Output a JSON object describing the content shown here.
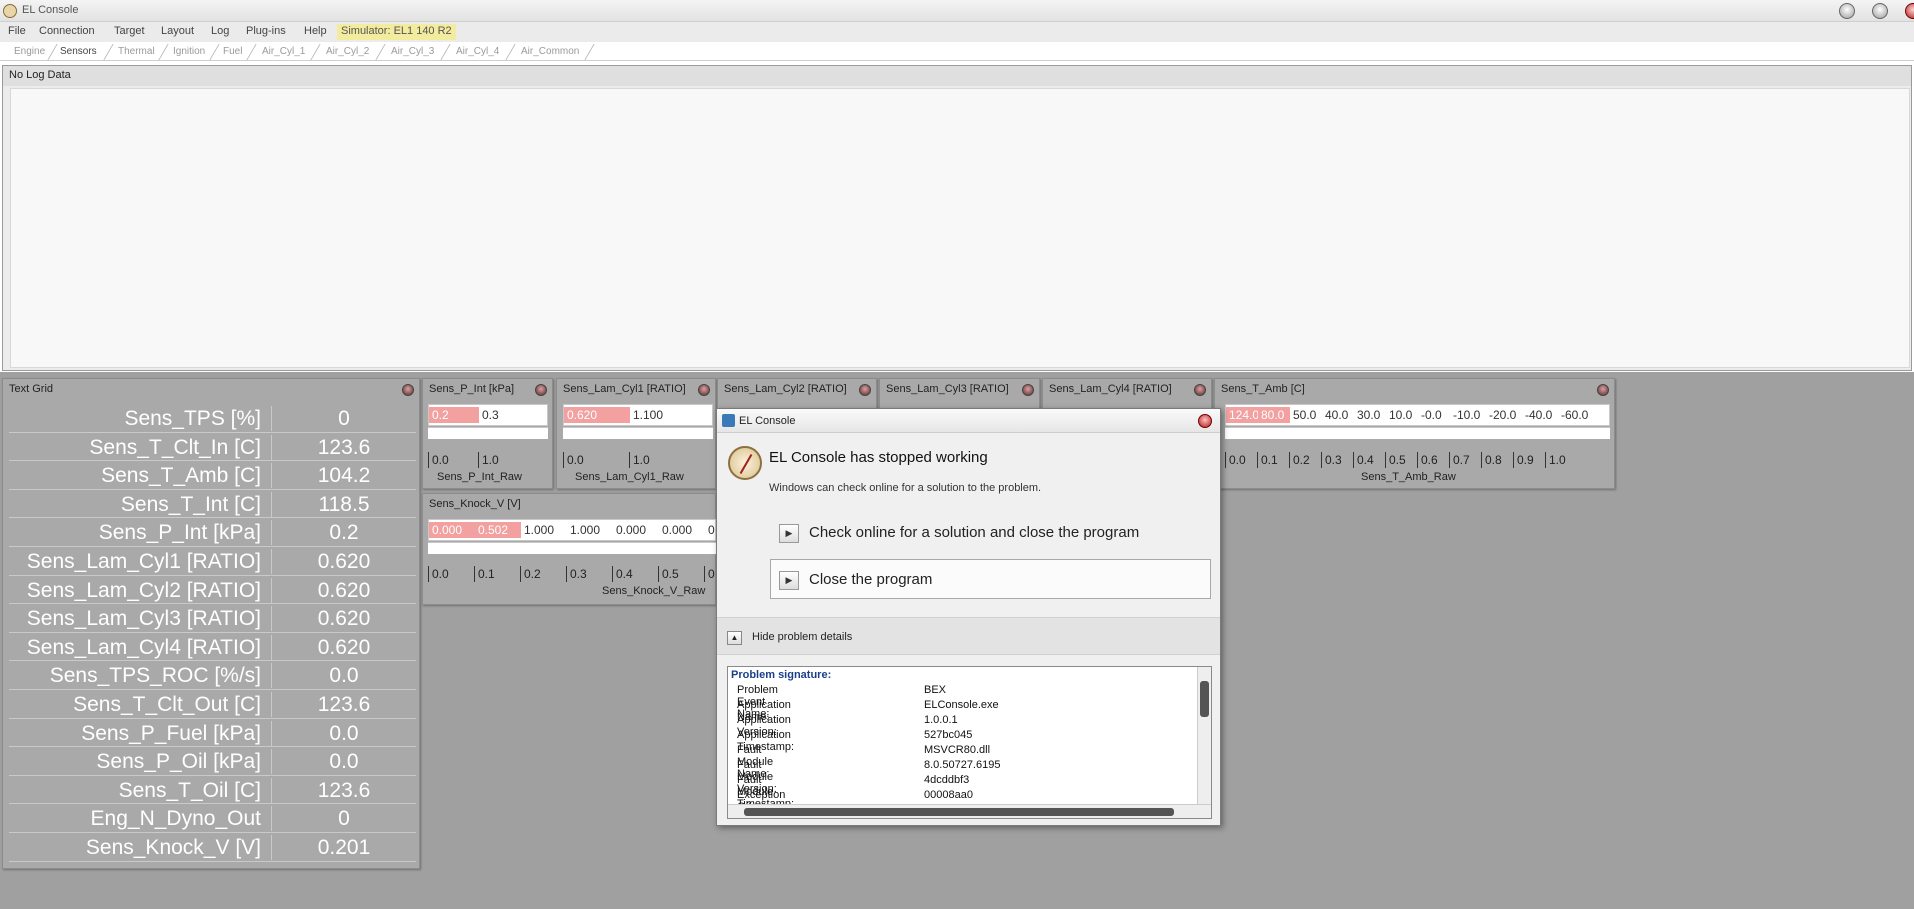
{
  "window": {
    "title": "EL Console"
  },
  "menu": {
    "items": [
      "File",
      "Connection",
      "Target",
      "Layout",
      "Log",
      "Plug-ins",
      "Help"
    ],
    "simulator": "Simulator: EL1 140 R2"
  },
  "tabs": [
    "Engine",
    "Sensors",
    "Thermal",
    "Ignition",
    "Fuel",
    "Air_Cyl_1",
    "Air_Cyl_2",
    "Air_Cyl_3",
    "Air_Cyl_4",
    "Air_Common"
  ],
  "active_tab": "Sensors",
  "log": {
    "header": "No Log Data"
  },
  "text_grid": {
    "title": "Text Grid",
    "rows": [
      {
        "label": "Sens_TPS [%]",
        "value": "0"
      },
      {
        "label": "Sens_T_Clt_In [C]",
        "value": "123.6"
      },
      {
        "label": "Sens_T_Amb [C]",
        "value": "104.2"
      },
      {
        "label": "Sens_T_Int [C]",
        "value": "118.5"
      },
      {
        "label": "Sens_P_Int [kPa]",
        "value": "0.2"
      },
      {
        "label": "Sens_Lam_Cyl1 [RATIO]",
        "value": "0.620"
      },
      {
        "label": "Sens_Lam_Cyl2 [RATIO]",
        "value": "0.620"
      },
      {
        "label": "Sens_Lam_Cyl3 [RATIO]",
        "value": "0.620"
      },
      {
        "label": "Sens_Lam_Cyl4 [RATIO]",
        "value": "0.620"
      },
      {
        "label": "Sens_TPS_ROC [%/s]",
        "value": "0.0"
      },
      {
        "label": "Sens_T_Clt_Out [C]",
        "value": "123.6"
      },
      {
        "label": "Sens_P_Fuel [kPa]",
        "value": "0.0"
      },
      {
        "label": "Sens_P_Oil [kPa]",
        "value": "0.0"
      },
      {
        "label": "Sens_T_Oil [C]",
        "value": "123.6"
      },
      {
        "label": "Eng_N_Dyno_Out",
        "value": "0"
      },
      {
        "label": "Sens_Knock_V [V]",
        "value": "0.201"
      }
    ]
  },
  "map_panels": {
    "p_int": {
      "title": "Sens_P_Int [kPa]",
      "cells": [
        "0.2",
        "0.3"
      ],
      "axis": [
        "0.0",
        "1.0"
      ],
      "raw": "Sens_P_Int_Raw"
    },
    "lam1": {
      "title": "Sens_Lam_Cyl1 [RATIO]",
      "cells": [
        "0.620",
        "1.100"
      ],
      "axis": [
        "0.0",
        "1.0"
      ],
      "raw": "Sens_Lam_Cyl1_Raw"
    },
    "lam2": {
      "title": "Sens_Lam_Cyl2 [RATIO]"
    },
    "lam3": {
      "title": "Sens_Lam_Cyl3 [RATIO]"
    },
    "lam4": {
      "title": "Sens_Lam_Cyl4 [RATIO]"
    },
    "t_amb": {
      "title": "Sens_T_Amb [C]",
      "cells": [
        "124.0",
        "80.0",
        "50.0",
        "40.0",
        "30.0",
        "10.0",
        "-0.0",
        "-10.0",
        "-20.0",
        "-40.0",
        "-60.0"
      ],
      "axis": [
        "0.0",
        "0.1",
        "0.2",
        "0.3",
        "0.4",
        "0.5",
        "0.6",
        "0.7",
        "0.8",
        "0.9",
        "1.0"
      ],
      "raw": "Sens_T_Amb_Raw"
    },
    "knock": {
      "title": "Sens_Knock_V [V]",
      "cells": [
        "0.000",
        "0.502",
        "1.000",
        "1.000",
        "0.000",
        "0.000",
        "0"
      ],
      "axis": [
        "0.0",
        "0.1",
        "0.2",
        "0.3",
        "0.4",
        "0.5",
        "0"
      ],
      "raw": "Sens_Knock_V_Raw"
    }
  },
  "dialog": {
    "title": "EL Console",
    "headline": "EL Console has stopped working",
    "subtext": "Windows can check online for a solution to the problem.",
    "option_check": "Check online for a solution and close the program",
    "option_close": "Close the program",
    "details_toggle": "Hide problem details",
    "signature_header": "Problem signature:",
    "signature": [
      {
        "key": "Problem Event Name:",
        "value": "BEX"
      },
      {
        "key": "Application Name:",
        "value": "ELConsole.exe"
      },
      {
        "key": "Application Version:",
        "value": "1.0.0.1"
      },
      {
        "key": "Application Timestamp:",
        "value": "527bc045"
      },
      {
        "key": "Fault Module Name:",
        "value": "MSVCR80.dll"
      },
      {
        "key": "Fault Module Version:",
        "value": "8.0.50727.6195"
      },
      {
        "key": "Fault Module Timestamp:",
        "value": "4dcddbf3"
      },
      {
        "key": "Exception Offset:",
        "value": "00008aa0"
      }
    ]
  },
  "colors": {
    "highlight_cell": "#f2a0a0",
    "workspace": "#a0a0a0",
    "simulator_badge": "#f3eb9e"
  }
}
